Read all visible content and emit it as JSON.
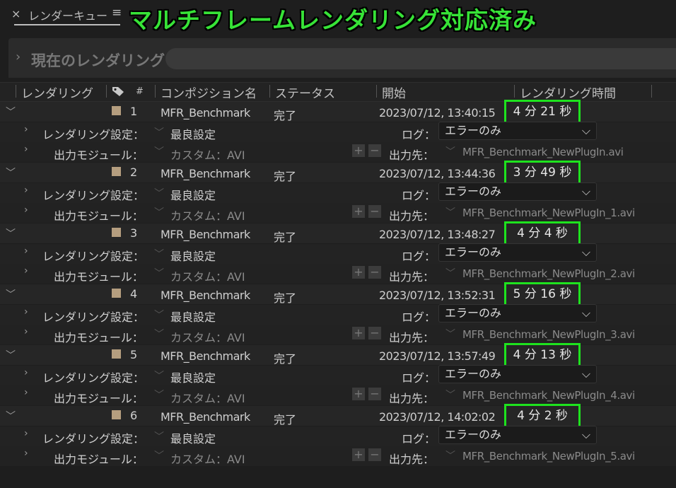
{
  "panel": {
    "close_label": "×",
    "tab_label": "レンダーキュー",
    "menu_glyph": "≡",
    "overlay_title": "マルチフレームレンダリング対応済み"
  },
  "current": {
    "label": "現在のレンダリング"
  },
  "headers": {
    "render": "レンダリング",
    "number": "#",
    "comp": "コンポジション名",
    "status": "ステータス",
    "start": "開始",
    "render_time": "レンダリング時間"
  },
  "sub_labels": {
    "render_settings": "レンダリング設定：",
    "output_module": "出力モジュール：",
    "log": "ログ：",
    "output_to": "出力先："
  },
  "colors": {
    "highlight_box": "#1ee31e",
    "label_swatch": "#b59e7f",
    "overlay_text": "#37e337"
  },
  "items": [
    {
      "num": "1",
      "comp": "MFR_Benchmark",
      "status": "完了",
      "start": "2023/07/12, 13:40:15",
      "time": "4 分 21 秒",
      "settings": "最良設定",
      "log": "エラーのみ",
      "module": "カスタム：AVI",
      "output": "MFR_Benchmark_NewPlugIn.avi"
    },
    {
      "num": "2",
      "comp": "MFR_Benchmark",
      "status": "完了",
      "start": "2023/07/12, 13:44:36",
      "time": "3 分 49 秒",
      "settings": "最良設定",
      "log": "エラーのみ",
      "module": "カスタム：AVI",
      "output": "MFR_Benchmark_NewPlugIn_1.avi"
    },
    {
      "num": "3",
      "comp": "MFR_Benchmark",
      "status": "完了",
      "start": "2023/07/12, 13:48:27",
      "time": "4 分 4 秒",
      "settings": "最良設定",
      "log": "エラーのみ",
      "module": "カスタム：AVI",
      "output": "MFR_Benchmark_NewPlugIn_2.avi"
    },
    {
      "num": "4",
      "comp": "MFR_Benchmark",
      "status": "完了",
      "start": "2023/07/12, 13:52:31",
      "time": "5 分 16 秒",
      "settings": "最良設定",
      "log": "エラーのみ",
      "module": "カスタム：AVI",
      "output": "MFR_Benchmark_NewPlugIn_3.avi"
    },
    {
      "num": "5",
      "comp": "MFR_Benchmark",
      "status": "完了",
      "start": "2023/07/12, 13:57:49",
      "time": "4 分 13 秒",
      "settings": "最良設定",
      "log": "エラーのみ",
      "module": "カスタム：AVI",
      "output": "MFR_Benchmark_NewPlugIn_4.avi"
    },
    {
      "num": "6",
      "comp": "MFR_Benchmark",
      "status": "完了",
      "start": "2023/07/12, 14:02:02",
      "time": "4 分 2 秒",
      "settings": "最良設定",
      "log": "エラーのみ",
      "module": "カスタム：AVI",
      "output": "MFR_Benchmark_NewPlugIn_5.avi"
    }
  ]
}
